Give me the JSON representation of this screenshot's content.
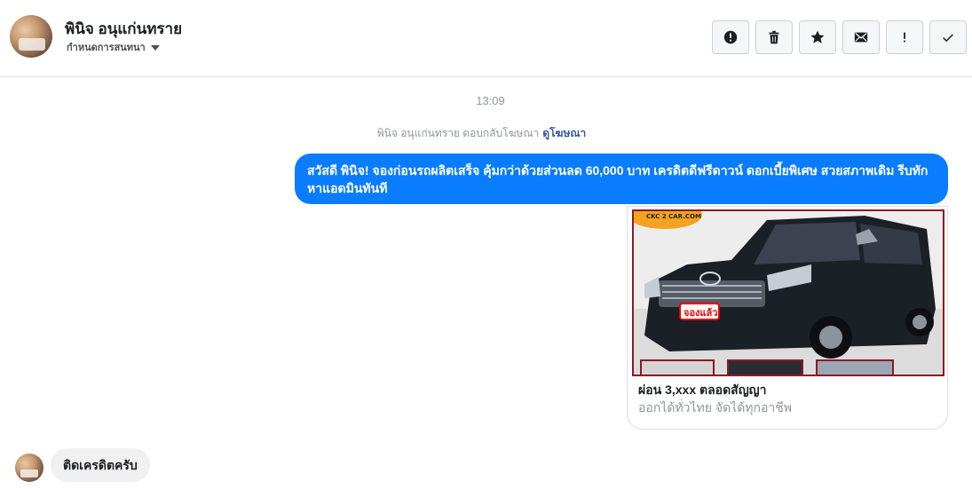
{
  "header": {
    "name": "พินิจ อนุแก่นทราย",
    "subtitle": "กำหนดการสนทนา",
    "toolbar": [
      {
        "icon": "alert-circle-icon",
        "name": "mark-spam-button"
      },
      {
        "icon": "trash-icon",
        "name": "delete-button"
      },
      {
        "icon": "star-icon",
        "name": "star-button"
      },
      {
        "icon": "envelope-icon",
        "name": "mark-unread-button"
      },
      {
        "icon": "exclamation-icon",
        "name": "priority-button"
      },
      {
        "icon": "check-icon",
        "name": "mark-done-button"
      }
    ]
  },
  "thread": {
    "timestamp": "13:09",
    "ad_reply_text": "พินิจ อนุแก่นทราย ตอบกลับโฆษณา",
    "ad_reply_link": "ดูโฆษณา",
    "outgoing_message": "สวัสดี พินิจ! จองก่อนรถผลิตเสร็จ คุ้มกว่าด้วยส่วนลด 60,000 บาท เครดิตดีฟรีดาวน์ ดอกเบี้ยพิเศษ สวยสภาพเดิม รีบทักหาแอดมินทันที",
    "ad_card": {
      "logo_text": "CKC 2 CAR.COM",
      "sticker_text": "จองแล้ว",
      "title": "ผ่อน 3,xxx ตลอดสัญญา",
      "description": "ออกได้ทั่วไทย จัดได้ทุกอาชีพ"
    },
    "incoming_message": "ติดเครดิตครับ"
  },
  "colors": {
    "accent": "#0a7cff",
    "incoming_bubble": "#f1f0f0",
    "link": "#385898",
    "muted": "#90949c"
  }
}
